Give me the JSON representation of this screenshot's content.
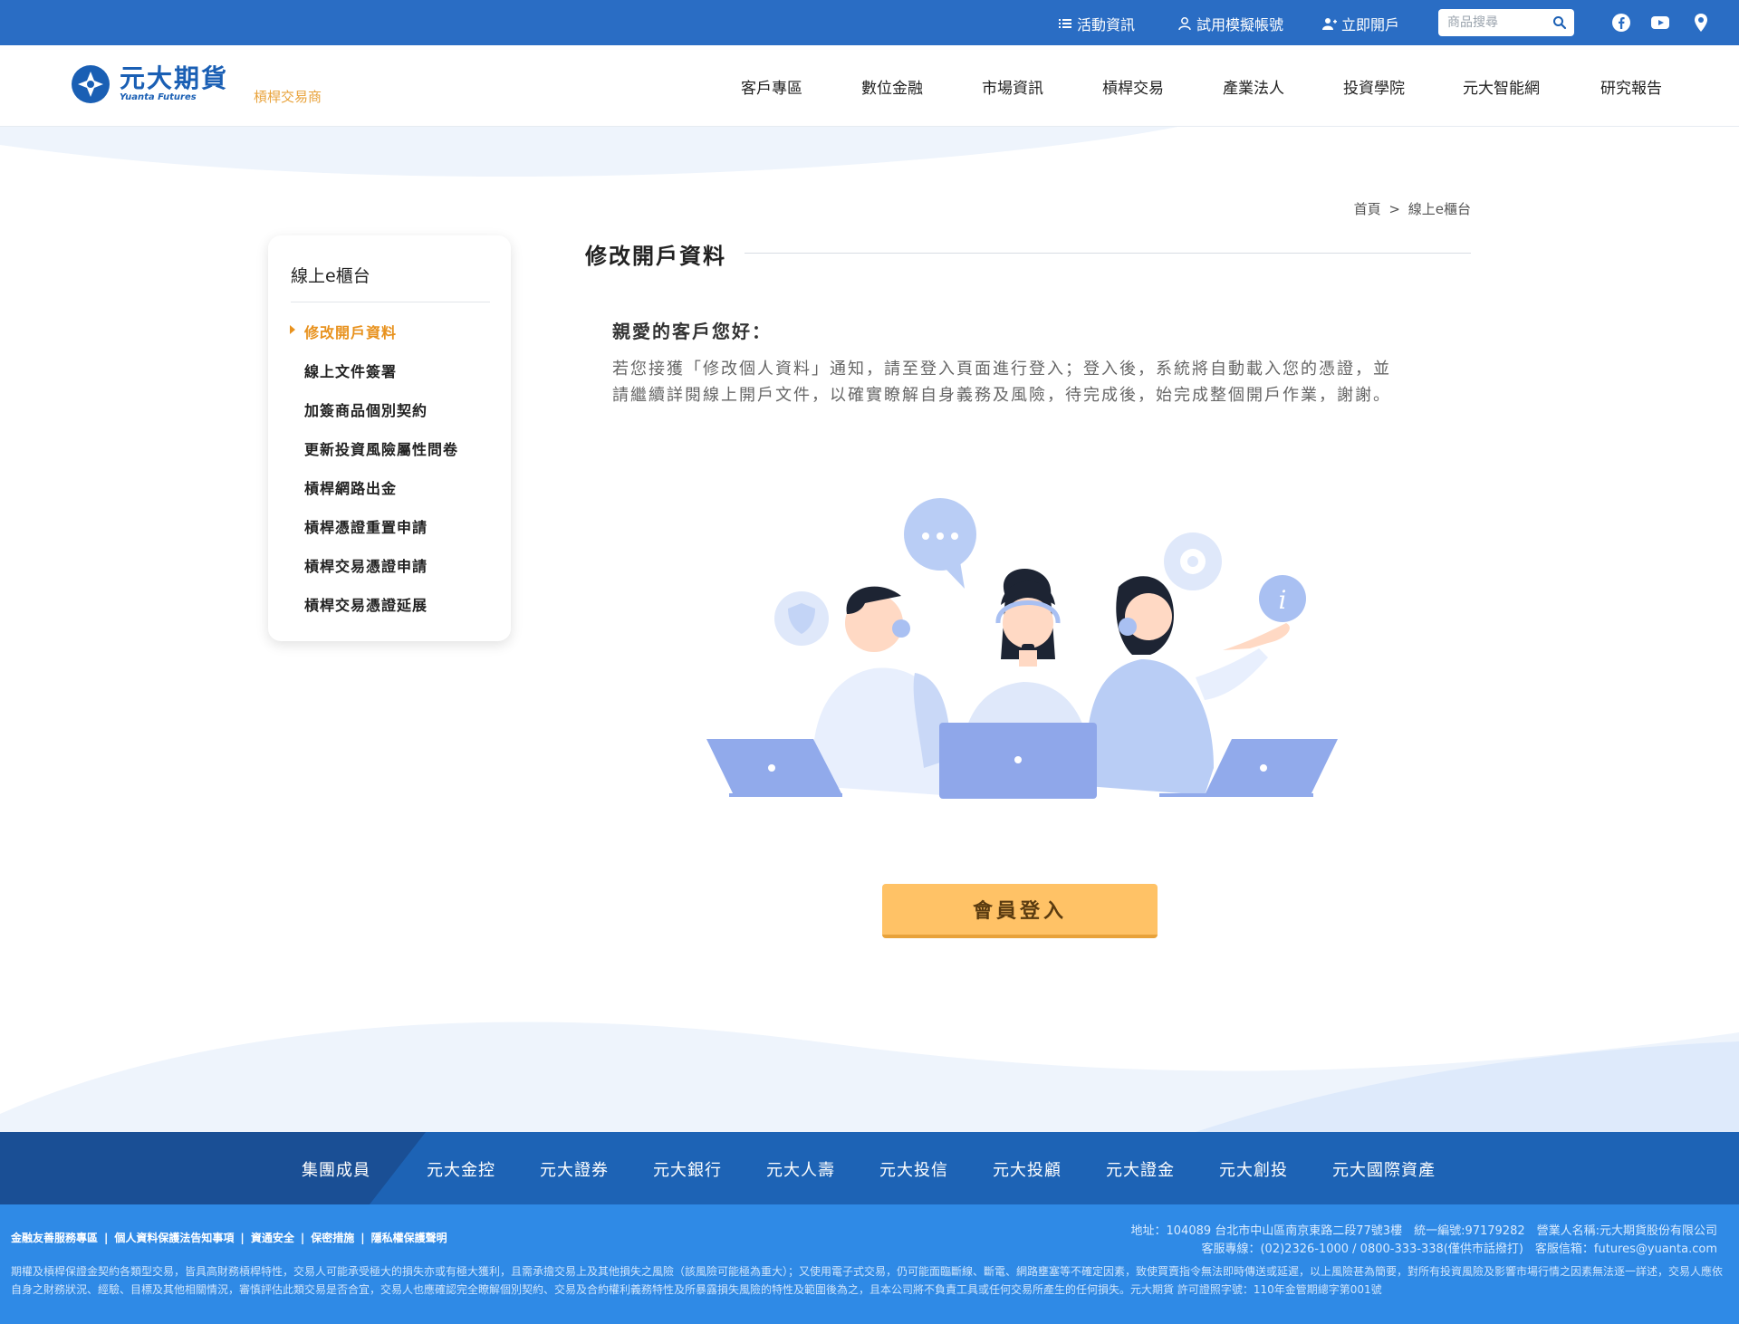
{
  "topbar": {
    "links": [
      {
        "label": "活動資訊",
        "icon": "list-icon"
      },
      {
        "label": "試用模擬帳號",
        "icon": "user-icon"
      },
      {
        "label": "立即開戶",
        "icon": "user-plus-icon"
      }
    ],
    "search_placeholder": "商品搜尋",
    "social": [
      "facebook-icon",
      "youtube-icon",
      "location-pin-icon"
    ]
  },
  "header": {
    "logo_cn": "元大期貨",
    "logo_en": "Yuanta Futures",
    "logo_sub": "槓桿交易商",
    "nav": [
      "客戶專區",
      "數位金融",
      "市場資訊",
      "槓桿交易",
      "產業法人",
      "投資學院",
      "元大智能網",
      "研究報告"
    ]
  },
  "breadcrumb": {
    "home": "首頁",
    "separator": ">",
    "current": "線上e櫃台"
  },
  "sidebar": {
    "title": "線上e櫃台",
    "items": [
      "修改開戶資料",
      "線上文件簽署",
      "加簽商品個別契約",
      "更新投資風險屬性問卷",
      "槓桿網路出金",
      "槓桿憑證重置申請",
      "槓桿交易憑證申請",
      "槓桿交易憑證延展"
    ],
    "active_index": 0
  },
  "main": {
    "title": "修改開戶資料",
    "greeting": "親愛的客戶您好：",
    "body_line1": "若您接獲「修改個人資料」通知，請至登入頁面進行登入；登入後，系統將自動載入您的憑證，並",
    "body_line2": "請繼續詳閱線上開戶文件，以確實瞭解自身義務及風險，待完成後，始完成整個開戶作業，謝謝。",
    "login_button": "會員登入"
  },
  "group": {
    "label": "集團成員",
    "members": [
      "元大金控",
      "元大證券",
      "元大銀行",
      "元大人壽",
      "元大投信",
      "元大投顧",
      "元大證金",
      "元大創投",
      "元大國際資產"
    ]
  },
  "footer": {
    "links": [
      "金融友善服務專區",
      "個人資料保護法告知事項",
      "資通安全",
      "保密措施",
      "隱私權保護聲明"
    ],
    "address": "地址：104089 台北市中山區南京東路二段77號3樓　統一編號:97179282　營業人名稱:元大期貨股份有限公司",
    "service": "客服專線：(02)2326-1000 / 0800-333-338(僅供市話撥打)　客服信箱：futures@yuanta.com",
    "disclaimer": "期權及槓桿保證金契約各類型交易，皆具高財務槓桿特性，交易人可能承受極大的損失亦或有極大獲利，且需承擔交易上及其他損失之風險（該風險可能極為重大）；又使用電子式交易，仍可能面臨斷線、斷電、網路壅塞等不確定因素，致使買賣指令無法即時傳送或延遲，以上風險甚為簡要，對所有投資風險及影響市場行情之因素無法逐一詳述，交易人應依自身之財務狀況、經驗、目標及其他相關情況，審慎評估此類交易是否合宜，交易人也應確認完全瞭解個別契約、交易及合約權利義務特性及所暴露損失風險的特性及範圍後為之，且本公司將不負責工具或任何交易所產生的任何損失。元大期貨 許可證照字號：110年金管期總字第001號"
  },
  "colors": {
    "topbar": "#2a6dc4",
    "brand_blue": "#1a5fb4",
    "accent_orange": "#e8921e",
    "button_yellow": "#ffc266",
    "footer_blue": "#2f8ae6",
    "group_blue": "#1d63b5"
  }
}
